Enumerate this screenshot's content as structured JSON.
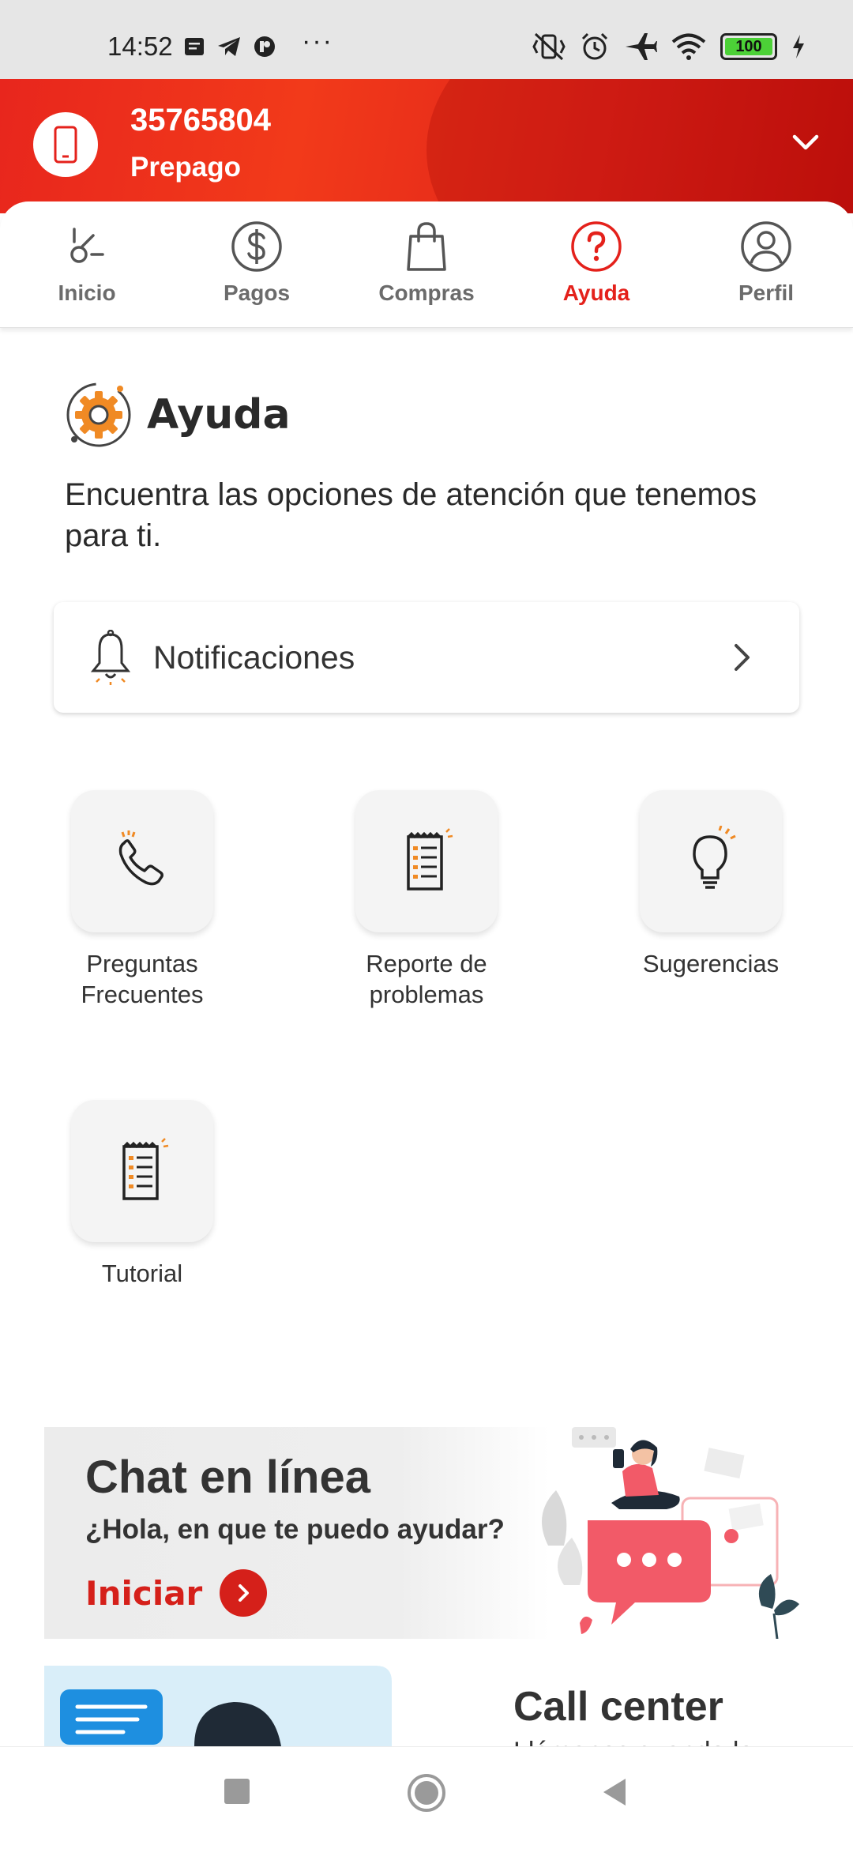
{
  "status_bar": {
    "time": "14:52",
    "dots": "···",
    "battery": "100",
    "icons": [
      "message-icon",
      "telegram-icon",
      "app-icon",
      "vibrate-off-icon",
      "alarm-icon",
      "airplane-icon",
      "wifi-icon",
      "battery-icon",
      "charging-icon"
    ]
  },
  "account": {
    "number": "35765804",
    "plan": "Prepago"
  },
  "tabs": [
    {
      "label": "Inicio",
      "icon": "home-icon",
      "active": false
    },
    {
      "label": "Pagos",
      "icon": "dollar-icon",
      "active": false
    },
    {
      "label": "Compras",
      "icon": "shopping-bag-icon",
      "active": false
    },
    {
      "label": "Ayuda",
      "icon": "help-icon",
      "active": true
    },
    {
      "label": "Perfil",
      "icon": "profile-icon",
      "active": false
    }
  ],
  "page": {
    "title": "Ayuda",
    "intro": "Encuentra las opciones de atención que tenemos para ti."
  },
  "notifications": {
    "label": "Notificaciones"
  },
  "options": [
    {
      "label_line1": "Preguntas",
      "label_line2": "Frecuentes",
      "icon": "phone-icon"
    },
    {
      "label_line1": "Reporte de",
      "label_line2": "problemas",
      "icon": "report-icon"
    },
    {
      "label_line1": "Sugerencias",
      "label_line2": "",
      "icon": "lightbulb-icon"
    },
    {
      "label_line1": "Tutorial",
      "label_line2": "",
      "icon": "document-icon"
    }
  ],
  "chat_banner": {
    "title": "Chat en línea",
    "subtitle": "¿Hola, en que te puedo ayudar?",
    "cta": "Iniciar"
  },
  "call_banner": {
    "title": "Call center",
    "subtitle": "Llámanos cuando lo"
  },
  "colors": {
    "brand_red": "#e4211b",
    "accent_orange": "#f08a24"
  }
}
